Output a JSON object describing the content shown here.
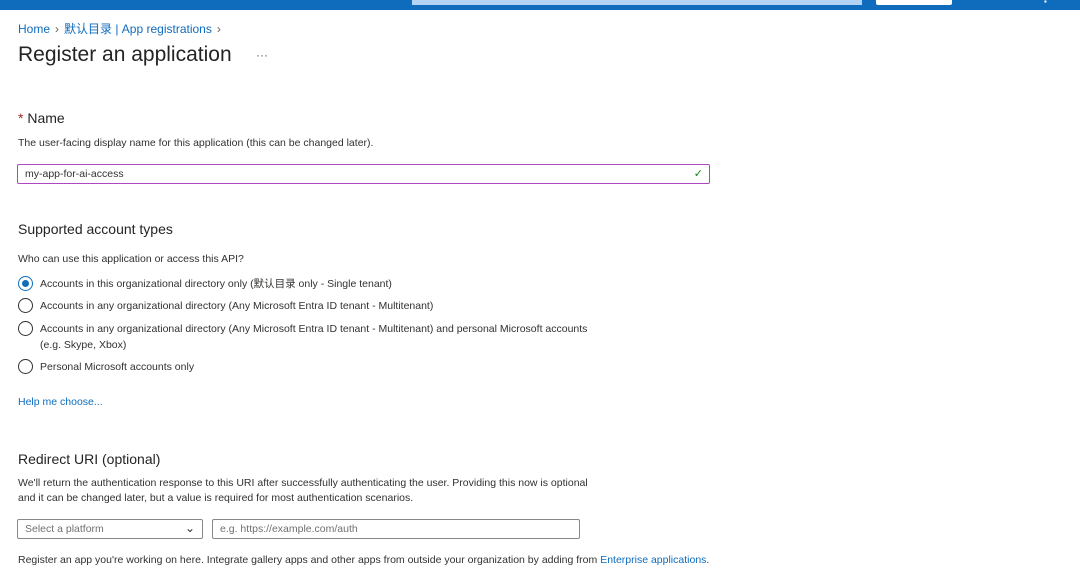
{
  "breadcrumb": [
    "Home",
    "默认目录 | App registrations"
  ],
  "page": {
    "title": "Register an application",
    "more": "···"
  },
  "name": {
    "required_mark": "*",
    "label": "Name",
    "description": "The user-facing display name for this application (this can be changed later).",
    "value": "my-app-for-ai-access"
  },
  "account_types": {
    "label": "Supported account types",
    "question": "Who can use this application or access this API?",
    "options": [
      {
        "label": "Accounts in this organizational directory only (默认目录 only - Single tenant)",
        "selected": true
      },
      {
        "label": "Accounts in any organizational directory (Any Microsoft Entra ID tenant - Multitenant)",
        "selected": false
      },
      {
        "label": "Accounts in any organizational directory (Any Microsoft Entra ID tenant - Multitenant) and personal Microsoft accounts (e.g. Skype, Xbox)",
        "selected": false
      },
      {
        "label": "Personal Microsoft accounts only",
        "selected": false
      }
    ],
    "help_link": "Help me choose..."
  },
  "redirect": {
    "label": "Redirect URI (optional)",
    "description": "We'll return the authentication response to this URI after successfully authenticating the user. Providing this now is optional and it can be changed later, but a value is required for most authentication scenarios.",
    "platform_placeholder": "Select a platform",
    "uri_placeholder": "e.g. https://example.com/auth"
  },
  "footer": {
    "text": "Register an app you're working on here. Integrate gallery apps and other apps from outside your organization by adding from ",
    "link": "Enterprise applications",
    "period": "."
  }
}
